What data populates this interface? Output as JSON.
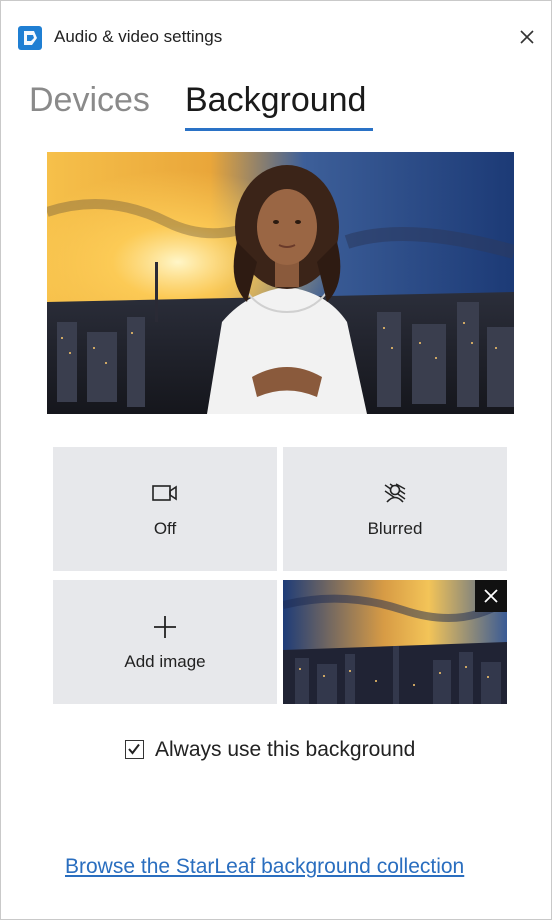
{
  "window": {
    "title": "Audio & video settings",
    "app_icon": "starleaf-logo-icon",
    "close_icon": "close-icon"
  },
  "tabs": [
    {
      "label": "Devices",
      "active": false
    },
    {
      "label": "Background",
      "active": true
    }
  ],
  "colors": {
    "accent": "#2a72c6",
    "tile_bg": "#e7e8eb",
    "link": "#2a6ebf",
    "inactive_tab": "#8a8a8a"
  },
  "preview": {
    "scene": "person-in-front-of-city-sunset-background"
  },
  "tiles": {
    "off": {
      "label": "Off",
      "icon": "camera-off-icon"
    },
    "blurred": {
      "label": "Blurred",
      "icon": "blur-icon"
    },
    "add_image": {
      "label": "Add image",
      "icon": "plus-icon"
    },
    "custom_image": {
      "icon": "remove-icon",
      "selected": true
    }
  },
  "always_use": {
    "label": "Always use this background",
    "checked": true
  },
  "browse_link": {
    "label": "Browse the StarLeaf background collection"
  }
}
